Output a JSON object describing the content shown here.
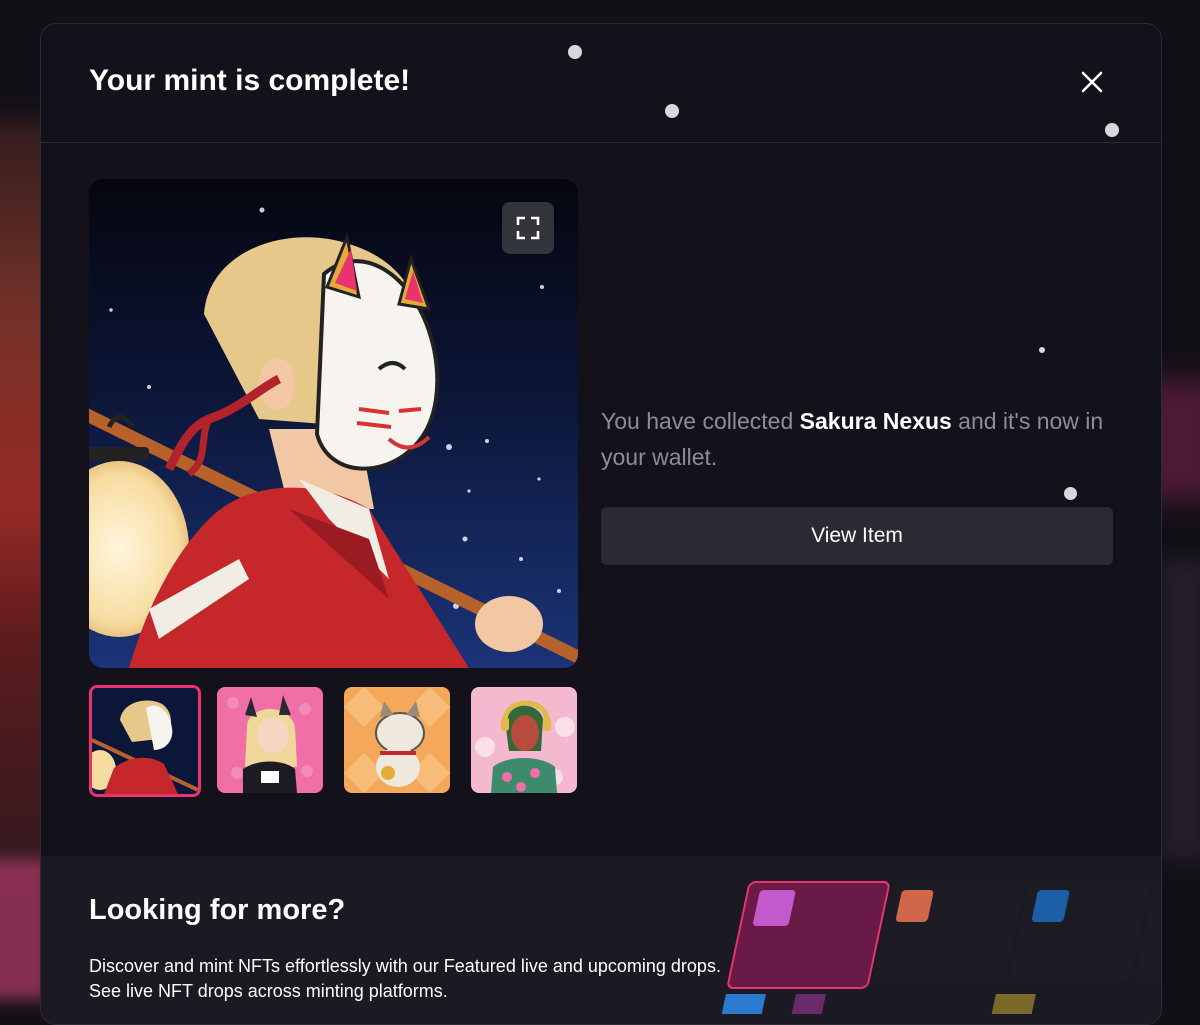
{
  "modal": {
    "title": "Your mint is complete!",
    "close_label": "×"
  },
  "item": {
    "message_prefix": "You have collected ",
    "name": "Sakura Nexus",
    "message_suffix": " and it's now in your wallet.",
    "view_button": "View Item"
  },
  "thumbnails": [
    {
      "name": "fox-mask-kimono",
      "selected": true
    },
    {
      "name": "blonde-cat-girl",
      "selected": false
    },
    {
      "name": "lucky-cat",
      "selected": false
    },
    {
      "name": "headphones-hawaiian",
      "selected": false
    }
  ],
  "more": {
    "title": "Looking for more?",
    "line1": "Discover and mint NFTs effortlessly with our Featured live and upcoming drops.",
    "line2": "See live NFT drops across minting platforms."
  },
  "colors": {
    "accent": "#e8336f",
    "modal_bg": "#13111a",
    "button_bg": "#2b2a33"
  }
}
